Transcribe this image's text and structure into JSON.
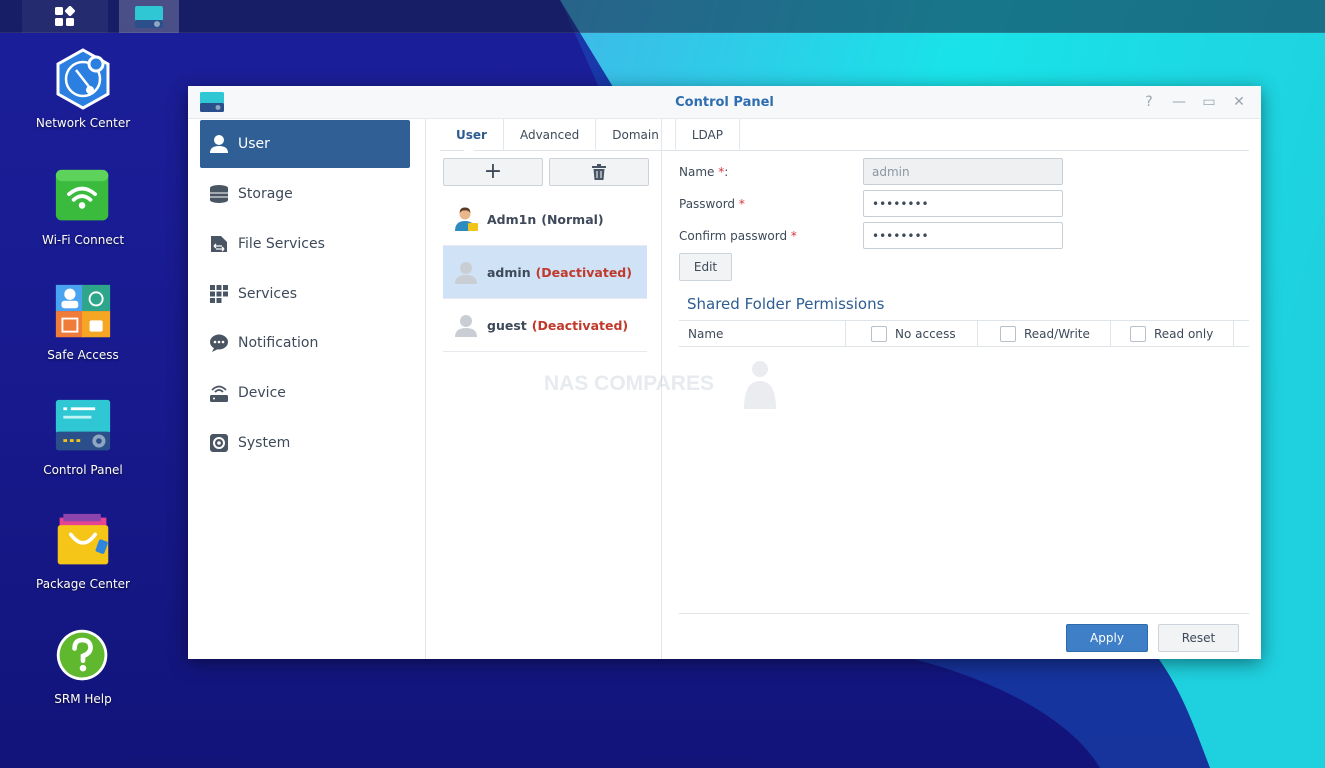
{
  "desktop": {
    "icons": [
      {
        "label": "Network Center"
      },
      {
        "label": "Wi-Fi Connect"
      },
      {
        "label": "Safe Access"
      },
      {
        "label": "Control Panel"
      },
      {
        "label": "Package Center"
      },
      {
        "label": "SRM Help"
      }
    ]
  },
  "window": {
    "title": "Control Panel",
    "controls": [
      "help-icon",
      "minimize-icon",
      "maximize-icon",
      "close-icon"
    ]
  },
  "sidebar": {
    "items": [
      {
        "label": "User",
        "icon": "user-icon",
        "active": true
      },
      {
        "label": "Storage",
        "icon": "storage-icon"
      },
      {
        "label": "File Services",
        "icon": "file-services-icon"
      },
      {
        "label": "Services",
        "icon": "services-icon"
      },
      {
        "label": "Notification",
        "icon": "notification-icon"
      },
      {
        "label": "Device",
        "icon": "device-icon"
      },
      {
        "label": "System",
        "icon": "system-icon"
      }
    ]
  },
  "tabs": [
    "User",
    "Advanced",
    "Domain",
    "LDAP"
  ],
  "users": [
    {
      "name": "Adm1n",
      "status": "(Normal)",
      "status_color": "#3e4a59"
    },
    {
      "name": "admin",
      "status": "(Deactivated)",
      "status_color": "#c0392b",
      "selected": true
    },
    {
      "name": "guest",
      "status": "(Deactivated)",
      "status_color": "#c0392b"
    }
  ],
  "form": {
    "name_label": "Name",
    "name_suffix": ":",
    "name_value": "admin",
    "password_label": "Password",
    "password_value": "••••••••",
    "confirm_label": "Confirm password",
    "confirm_value": "••••••••",
    "required_mark": "*",
    "edit_label": "Edit"
  },
  "permissions": {
    "title": "Shared Folder Permissions",
    "columns": [
      "Name",
      "No access",
      "Read/Write",
      "Read only"
    ]
  },
  "footer": {
    "apply_label": "Apply",
    "reset_label": "Reset"
  },
  "watermark": "NAS COMPARES",
  "colors": {
    "accent": "#2f5f95",
    "apply": "#3e7fc8",
    "deactivated": "#c0392b"
  }
}
